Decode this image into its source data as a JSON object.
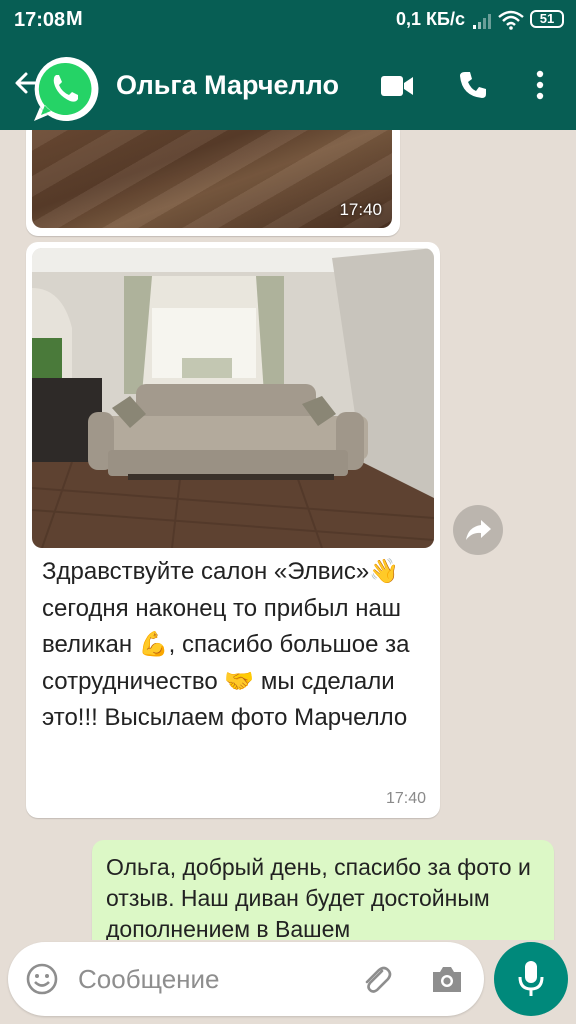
{
  "status_bar": {
    "time": "17:08",
    "notification_icon": "gmail-icon",
    "notification_glyph": "M",
    "speed": "0,1 КБ/с",
    "battery": "51"
  },
  "app_bar": {
    "contact_name": "Ольга Марчелло",
    "icons": [
      "back-arrow-icon",
      "whatsapp-icon",
      "video-call-icon",
      "phone-icon",
      "more-vert-icon"
    ],
    "color": "#075e54"
  },
  "messages": [
    {
      "type": "incoming-image",
      "time": "17:40"
    },
    {
      "type": "incoming-image-with-caption",
      "caption": "Здравствуйте салон «Элвис»👋 сегодня наконец то прибыл наш великан 💪, спасибо большое за сотрудничество 🤝 мы сделали это!!! Высылаем фото Марчелло",
      "time": "17:40"
    },
    {
      "type": "outgoing",
      "text": "Ольга, добрый день, спасибо за фото и отзыв. Наш диван будет достойным дополнением в Вашем"
    }
  ],
  "composer": {
    "placeholder": "Сообщение",
    "icons": [
      "emoji-icon",
      "attach-icon",
      "camera-icon",
      "mic-icon"
    ],
    "accent": "#00897b"
  },
  "colors": {
    "chat_bg": "#e5ddd5",
    "incoming_bubble": "#ffffff",
    "outgoing_bubble": "#dcf8c6"
  }
}
